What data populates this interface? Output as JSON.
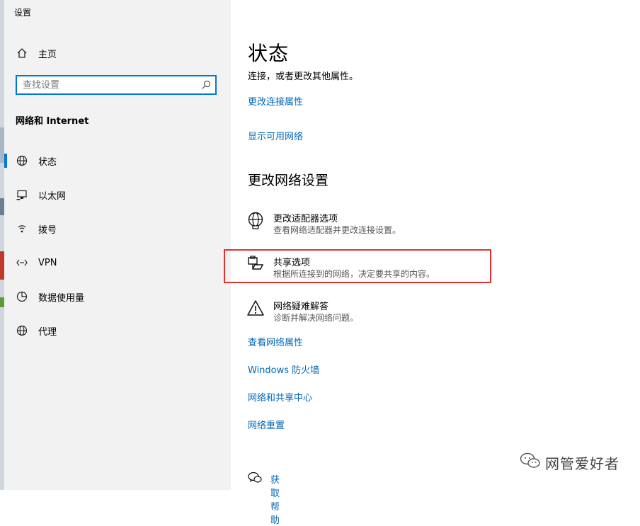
{
  "app": {
    "title": "设置"
  },
  "sidebar": {
    "home_label": "主页",
    "search_placeholder": "查找设置",
    "section_title": "网络和 Internet",
    "items": [
      {
        "label": "状态",
        "icon": "globe-icon",
        "active": true
      },
      {
        "label": "以太网",
        "icon": "ethernet-icon",
        "active": false
      },
      {
        "label": "拨号",
        "icon": "dialup-icon",
        "active": false
      },
      {
        "label": "VPN",
        "icon": "vpn-icon",
        "active": false
      },
      {
        "label": "数据使用量",
        "icon": "data-usage-icon",
        "active": false
      },
      {
        "label": "代理",
        "icon": "globe-icon",
        "active": false
      }
    ]
  },
  "main": {
    "title": "状态",
    "subtitle": "连接，或者更改其他属性。",
    "top_links": [
      "更改连接属性",
      "显示可用网络"
    ],
    "settings_heading": "更改网络设置",
    "settings_items": [
      {
        "title": "更改适配器选项",
        "desc": "查看网络适配器并更改连接设置。",
        "icon": "adapter-globe-icon"
      },
      {
        "title": "共享选项",
        "desc": "根据所连接到的网络，决定要共享的内容。",
        "icon": "sharing-printer-icon"
      },
      {
        "title": "网络疑难解答",
        "desc": "诊断并解决网络问题。",
        "icon": "warning-icon"
      }
    ],
    "bottom_links": [
      "查看网络属性",
      "Windows 防火墙",
      "网络和共享中心",
      "网络重置"
    ],
    "help_label": "获取帮助"
  },
  "watermark": {
    "text": "网管爱好者"
  },
  "colors": {
    "accent": "#0078d7",
    "link": "#0067b8",
    "highlight": "#e03131",
    "sidebar_bg": "#f2f2f2"
  }
}
